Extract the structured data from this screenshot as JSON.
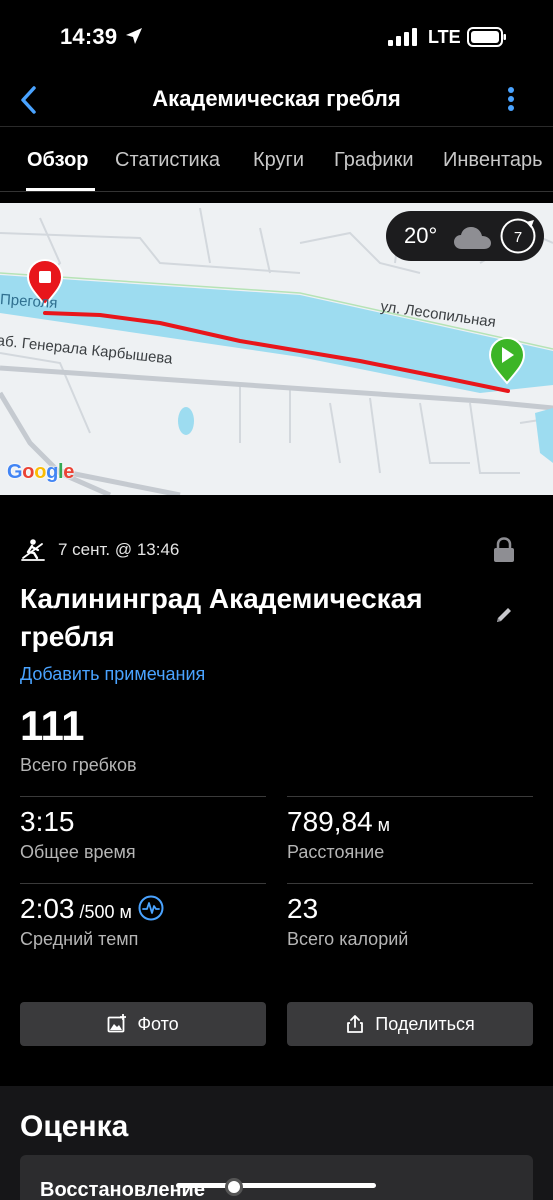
{
  "status_bar": {
    "time": "14:39",
    "network": "LTE"
  },
  "nav": {
    "title": "Академическая гребля"
  },
  "tabs": [
    {
      "label": "Обзор",
      "active": true
    },
    {
      "label": "Статистика",
      "active": false
    },
    {
      "label": "Круги",
      "active": false
    },
    {
      "label": "Графики",
      "active": false
    },
    {
      "label": "Инвентарь",
      "active": false
    }
  ],
  "map": {
    "labels": {
      "river": "Преголя",
      "street_1": "ул. Лесопильная",
      "street_2": "наб. Генерала Карбышева"
    },
    "weather": {
      "temperature": "20°",
      "wind": "7",
      "icon": "cloud-icon"
    },
    "provider": "Google",
    "route_color": "#e8161b",
    "water_color": "#9ddcf0"
  },
  "activity": {
    "sport_icon": "rowing-icon",
    "date": "7 сент. @ 13:46",
    "title": "Калининград Академическая гребля",
    "add_notes": "Добавить примечания",
    "total_strokes": {
      "value": "111",
      "label": "Всего гребков"
    },
    "stats": [
      {
        "value": "3:15",
        "unit": "",
        "label": "Общее время"
      },
      {
        "value": "789,84",
        "unit": " м",
        "label": "Расстояние"
      },
      {
        "value": "2:03",
        "unit": " /500 м",
        "label": "Средний темп"
      },
      {
        "value": "23",
        "unit": "",
        "label": "Всего калорий"
      }
    ]
  },
  "actions": {
    "photo": "Фото",
    "share": "Поделиться"
  },
  "rating": {
    "section_title": "Оценка",
    "card_label": "Восстановление"
  },
  "colors": {
    "accent": "#4aa3ff",
    "background": "#000000",
    "button": "#3a3a3c"
  }
}
